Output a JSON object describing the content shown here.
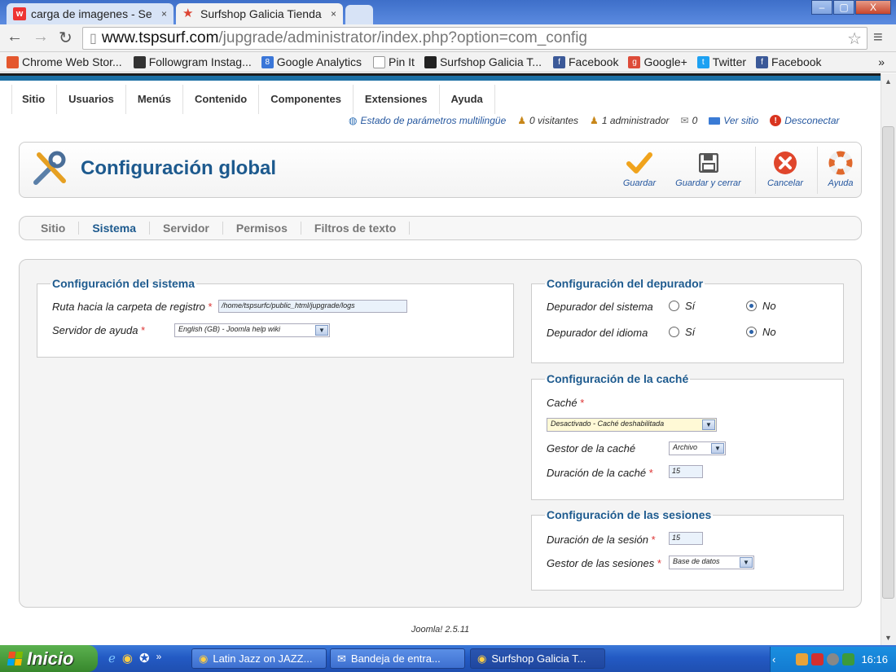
{
  "browser": {
    "tabs": [
      {
        "title": "carga de imagenes - Se",
        "close": "×",
        "icon": "w"
      },
      {
        "title": "Surfshop Galicia Tienda",
        "close": "×",
        "icon": "★"
      }
    ],
    "window_controls": {
      "minimize": "–",
      "maximize": "▢",
      "close": "X"
    },
    "url_domain": "www.tspsurf.com",
    "url_path": "/jupgrade/administrator/index.php?option=com_config",
    "bookmarks": [
      {
        "label": "Chrome Web Stor...",
        "color": "#e4572e"
      },
      {
        "label": "Followgram Instag...",
        "color": "#333333"
      },
      {
        "label": "Google Analytics",
        "color": "#3a76d8"
      },
      {
        "label": "Pin It",
        "color": "#ffffff"
      },
      {
        "label": "Surfshop Galicia T...",
        "color": "#222222"
      },
      {
        "label": "Facebook",
        "color": "#3b5998"
      },
      {
        "label": "Google+",
        "color": "#dd4b39"
      },
      {
        "label": "Twitter",
        "color": "#1da1f2"
      },
      {
        "label": "Facebook",
        "color": "#3b5998"
      }
    ],
    "bookmarks_more": "»"
  },
  "joomla": {
    "menu": [
      "Sitio",
      "Usuarios",
      "Menús",
      "Contenido",
      "Componentes",
      "Extensiones",
      "Ayuda"
    ],
    "status": {
      "multilang": "Estado de parámetros multilingüe",
      "visitors": "0 visitantes",
      "admins": "1 administrador",
      "messages": "0",
      "view_site": "Ver sitio",
      "logout": "Desconectar"
    },
    "page_title": "Configuración global",
    "toolbar": {
      "save": "Guardar",
      "save_close": "Guardar y cerrar",
      "cancel": "Cancelar",
      "help": "Ayuda"
    },
    "subtabs": [
      "Sitio",
      "Sistema",
      "Servidor",
      "Permisos",
      "Filtros de texto"
    ],
    "active_subtab": "Sistema",
    "system": {
      "legend": "Configuración del sistema",
      "log_path_label": "Ruta hacia la carpeta de registro",
      "log_path_value": "/home/tspsurfc/public_html/jupgrade/logs",
      "help_server_label": "Servidor de ayuda",
      "help_server_value": "English (GB) - Joomla help wiki"
    },
    "debug": {
      "legend": "Configuración del depurador",
      "system_debug_label": "Depurador del sistema",
      "language_debug_label": "Depurador del idioma",
      "yes": "Sí",
      "no": "No",
      "system_debug_value": "No",
      "language_debug_value": "No"
    },
    "cache": {
      "legend": "Configuración de la caché",
      "cache_label": "Caché",
      "cache_value": "Desactivado - Caché deshabilitada",
      "handler_label": "Gestor de la caché",
      "handler_value": "Archivo",
      "time_label": "Duración de la caché",
      "time_value": "15"
    },
    "session": {
      "legend": "Configuración de las sesiones",
      "lifetime_label": "Duración de la sesión",
      "lifetime_value": "15",
      "handler_label": "Gestor de las sesiones",
      "handler_value": "Base de datos"
    },
    "required_mark": "*",
    "footer": "Joomla! 2.5.11"
  },
  "taskbar": {
    "start": "Inicio",
    "quicklaunch_more": "»",
    "tasks": [
      "Latin Jazz on JAZZ...",
      "Bandeja de entra...",
      "Surfshop Galicia T..."
    ],
    "clock": "16:16"
  }
}
